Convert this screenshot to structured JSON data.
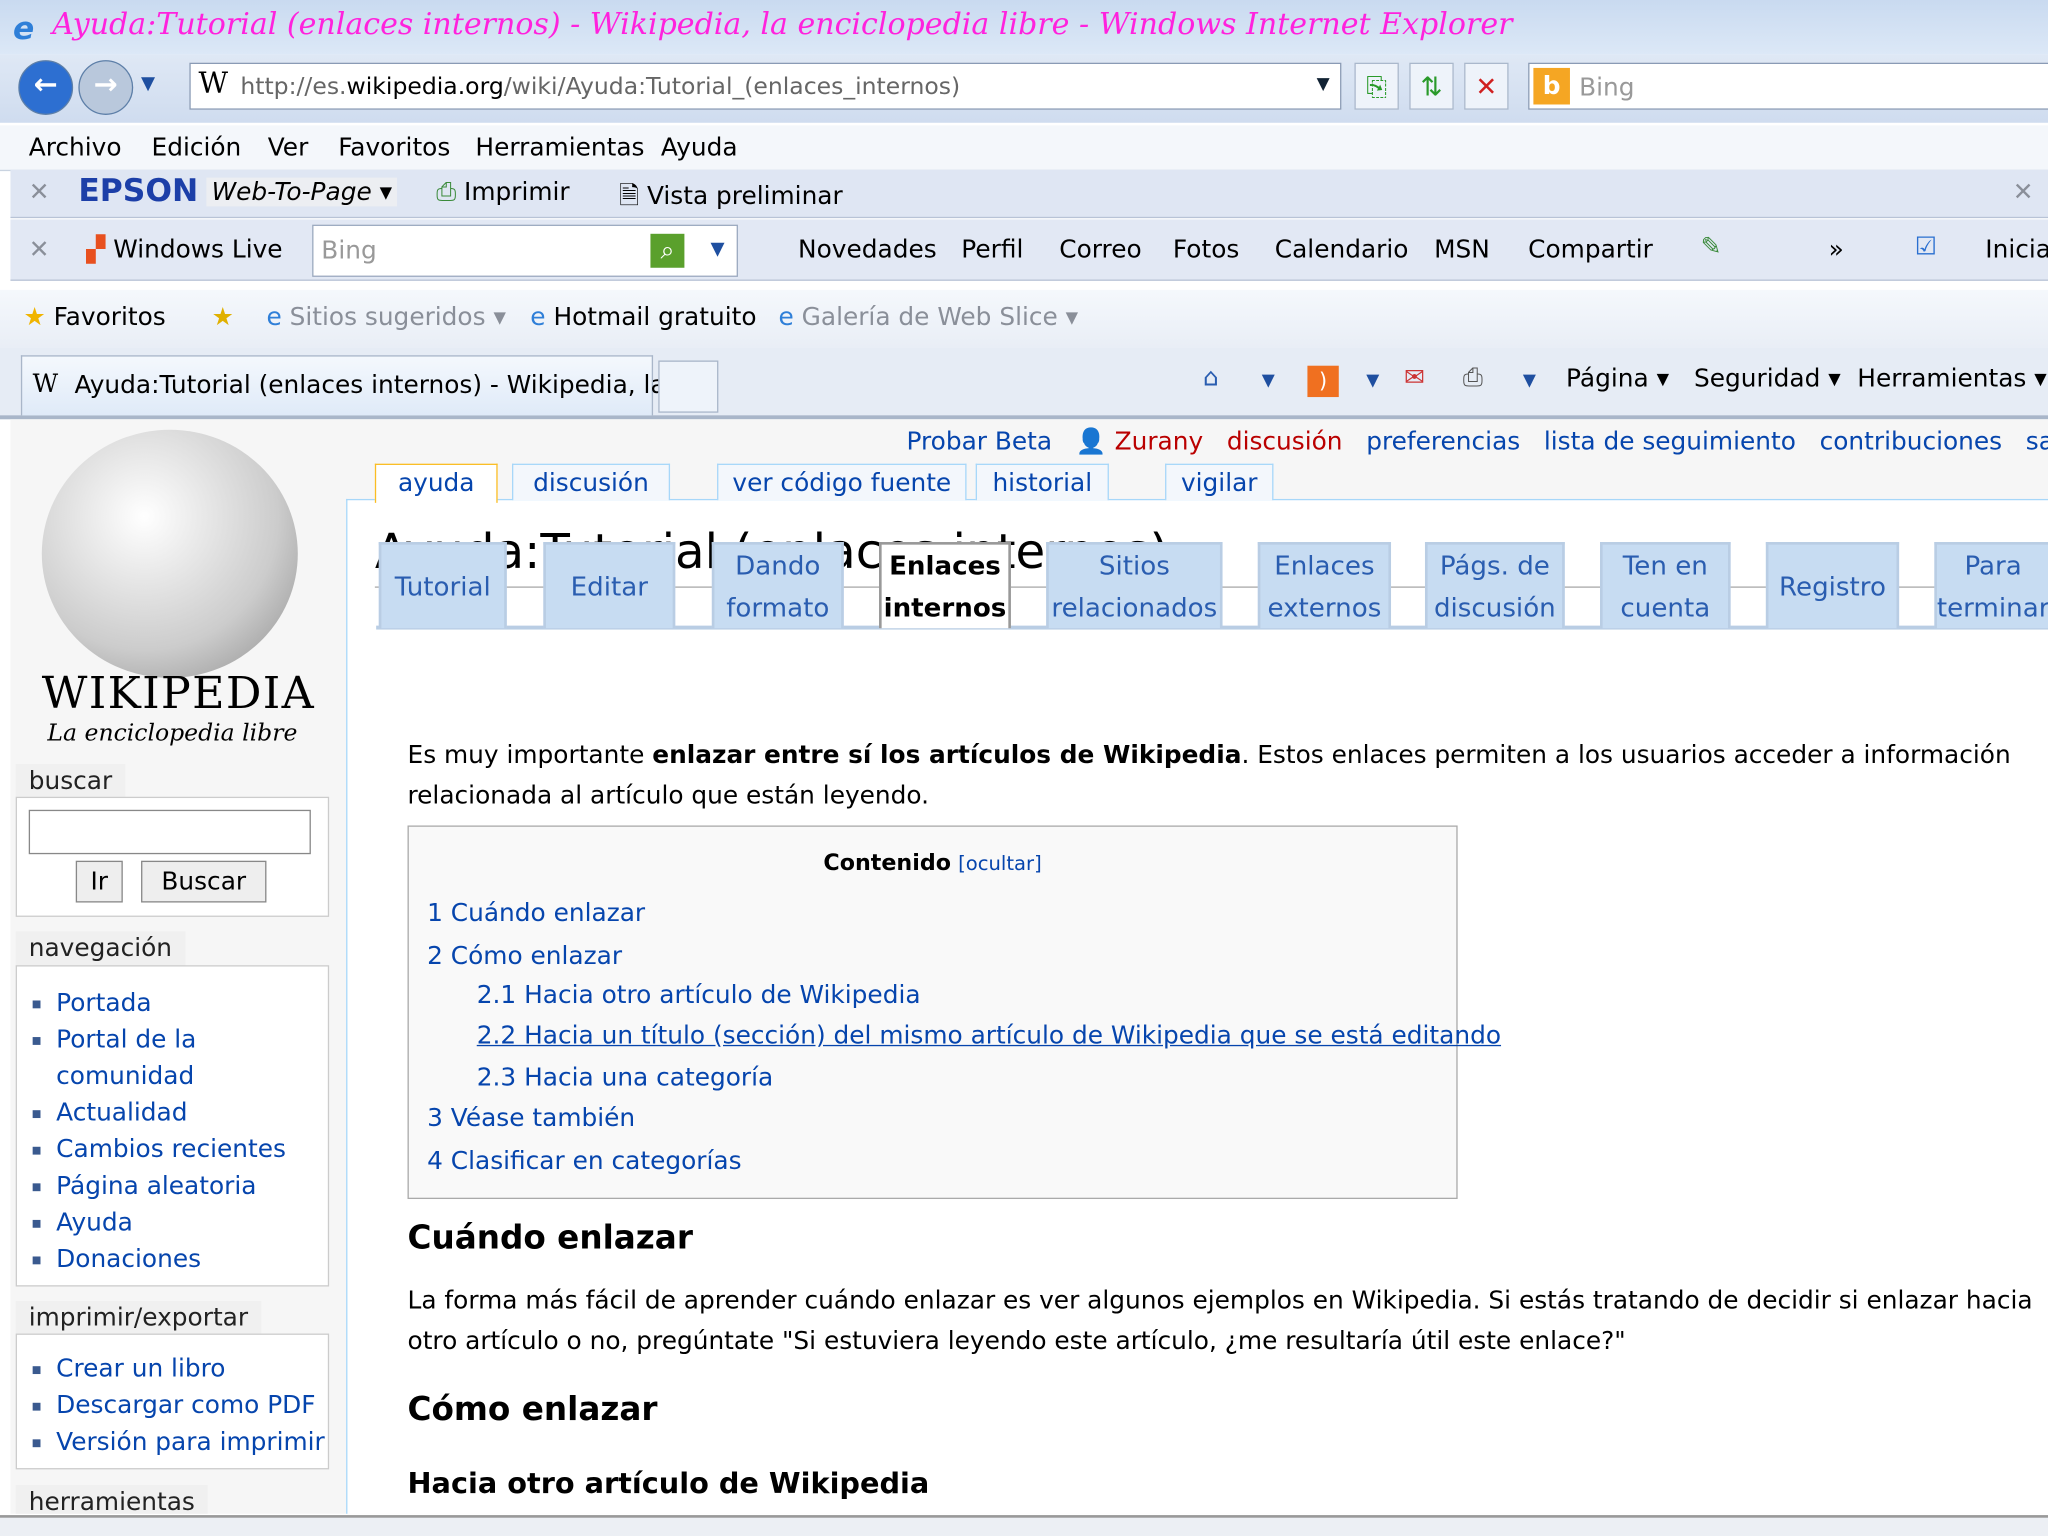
{
  "window": {
    "title": "Ayuda:Tutorial (enlaces internos) - Wikipedia, la enciclopedia libre - Windows Internet Explorer"
  },
  "address": {
    "url_prefix": "http://es.",
    "url_host": "wikipedia.org",
    "url_path": "/wiki/Ayuda:Tutorial_(enlaces_internos)",
    "search_placeholder": "Bing"
  },
  "menu": [
    "Archivo",
    "Edición",
    "Ver",
    "Favoritos",
    "Herramientas",
    "Ayuda"
  ],
  "epson": {
    "brand": "EPSON",
    "web_to_page": "Web-To-Page",
    "print": "Imprimir",
    "preview": "Vista preliminar"
  },
  "live": {
    "brand": "Windows Live",
    "search_placeholder": "Bing",
    "links": [
      "Novedades",
      "Perfil",
      "Correo",
      "Fotos",
      "Calendario",
      "MSN",
      "Compartir"
    ],
    "more": "»",
    "signin": "Inicia"
  },
  "favorites": {
    "label": "Favoritos",
    "suggested": "Sitios sugeridos",
    "hotmail": "Hotmail gratuito",
    "gallery": "Galería de Web Slice"
  },
  "tab": {
    "title": "Ayuda:Tutorial (enlaces internos) - Wikipedia, la ..."
  },
  "command": {
    "page": "Página",
    "security": "Seguridad",
    "tools": "Herramientas"
  },
  "wiki": {
    "logo_title": "WIKIPEDIA",
    "logo_sub": "La enciclopedia libre",
    "personal": {
      "beta": "Probar Beta",
      "user": "Zurany",
      "talk": "discusión",
      "prefs": "preferencias",
      "watchlist": "lista de seguimiento",
      "contribs": "contribuciones",
      "logout": "sa"
    },
    "page_tabs": [
      "ayuda",
      "discusión",
      "ver código fuente",
      "historial",
      "vigilar"
    ],
    "search": {
      "label": "buscar",
      "go": "Ir",
      "search": "Buscar"
    },
    "nav": {
      "label": "navegación",
      "items": [
        "Portada",
        "Portal de la comunidad",
        "Actualidad",
        "Cambios recientes",
        "Página aleatoria",
        "Ayuda",
        "Donaciones"
      ]
    },
    "print": {
      "label": "imprimir/exportar",
      "items": [
        "Crear un libro",
        "Descargar como PDF",
        "Versión para imprimir"
      ]
    },
    "tools": {
      "label": "herramientas"
    },
    "title": "Ayuda:Tutorial (enlaces internos)",
    "tut_tabs": [
      [
        "Tutorial",
        ""
      ],
      [
        "Editar",
        ""
      ],
      [
        "Dando",
        "formato"
      ],
      [
        "Enlaces",
        "internos"
      ],
      [
        "Sitios",
        "relacionados"
      ],
      [
        "Enlaces",
        "externos"
      ],
      [
        "Págs. de",
        "discusión"
      ],
      [
        "Ten en",
        "cuenta"
      ],
      [
        "Registro",
        ""
      ],
      [
        "Para",
        "terminar"
      ]
    ],
    "intro_a": "Es muy importante ",
    "intro_b": "enlazar entre sí los artículos de Wikipedia",
    "intro_c": ". Estos enlaces permiten a los usuarios acceder a información",
    "intro_d": "relacionada al artículo que están leyendo.",
    "toc": {
      "title": "Contenido",
      "hide": "[ocultar]",
      "items": [
        "1 Cuándo enlazar",
        "2 Cómo enlazar",
        "2.1 Hacia otro artículo de Wikipedia",
        "2.2 Hacia un título (sección) del mismo artículo de Wikipedia que se está editando",
        "2.3 Hacia una categoría",
        "3 Véase también",
        "4 Clasificar en categorías"
      ]
    },
    "h1": "Cuándo enlazar",
    "p1a": "La forma más fácil de aprender cuándo enlazar es ver algunos ejemplos en Wikipedia. Si estás tratando de decidir si enlazar hacia",
    "p1b": "otro artículo o no, pregúntate \"Si estuviera leyendo este artículo, ¿me resultaría útil este enlace?\"",
    "h2": "Cómo enlazar",
    "h3": "Hacia otro artículo de Wikipedia"
  }
}
